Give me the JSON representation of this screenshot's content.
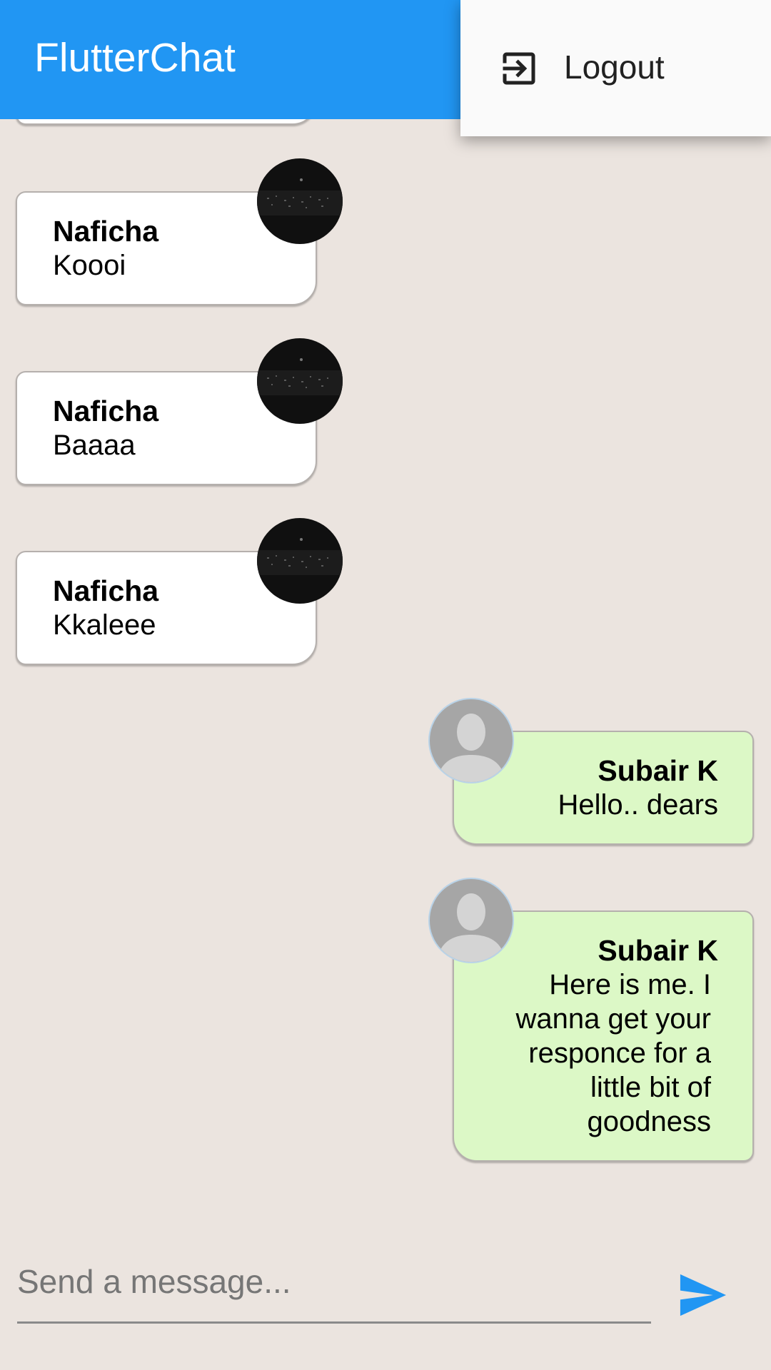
{
  "app": {
    "title": "FlutterChat"
  },
  "menu": {
    "items": [
      {
        "label": "Logout",
        "icon": "logout-icon"
      }
    ]
  },
  "messages": [
    {
      "sender": "Naficha",
      "text": "Koooi",
      "direction": "incoming",
      "avatar": "user-photo"
    },
    {
      "sender": "Naficha",
      "text": "Baaaa",
      "direction": "incoming",
      "avatar": "user-photo"
    },
    {
      "sender": "Naficha",
      "text": "Kkaleee",
      "direction": "incoming",
      "avatar": "user-photo"
    },
    {
      "sender": "Subair K",
      "text": "Hello.. dears",
      "direction": "outgoing",
      "avatar": "default-avatar-icon"
    },
    {
      "sender": "Subair K",
      "text": "Here is me. I wanna get your responce for a little bit of goodness",
      "direction": "outgoing",
      "avatar": "default-avatar-icon"
    }
  ],
  "composer": {
    "placeholder": "Send a message...",
    "value": ""
  },
  "colors": {
    "appbar": "#2196f3",
    "background": "#ebe4df",
    "outgoing_bubble": "#dcf8c6",
    "incoming_bubble": "#ffffff",
    "send_icon": "#2196f3"
  }
}
